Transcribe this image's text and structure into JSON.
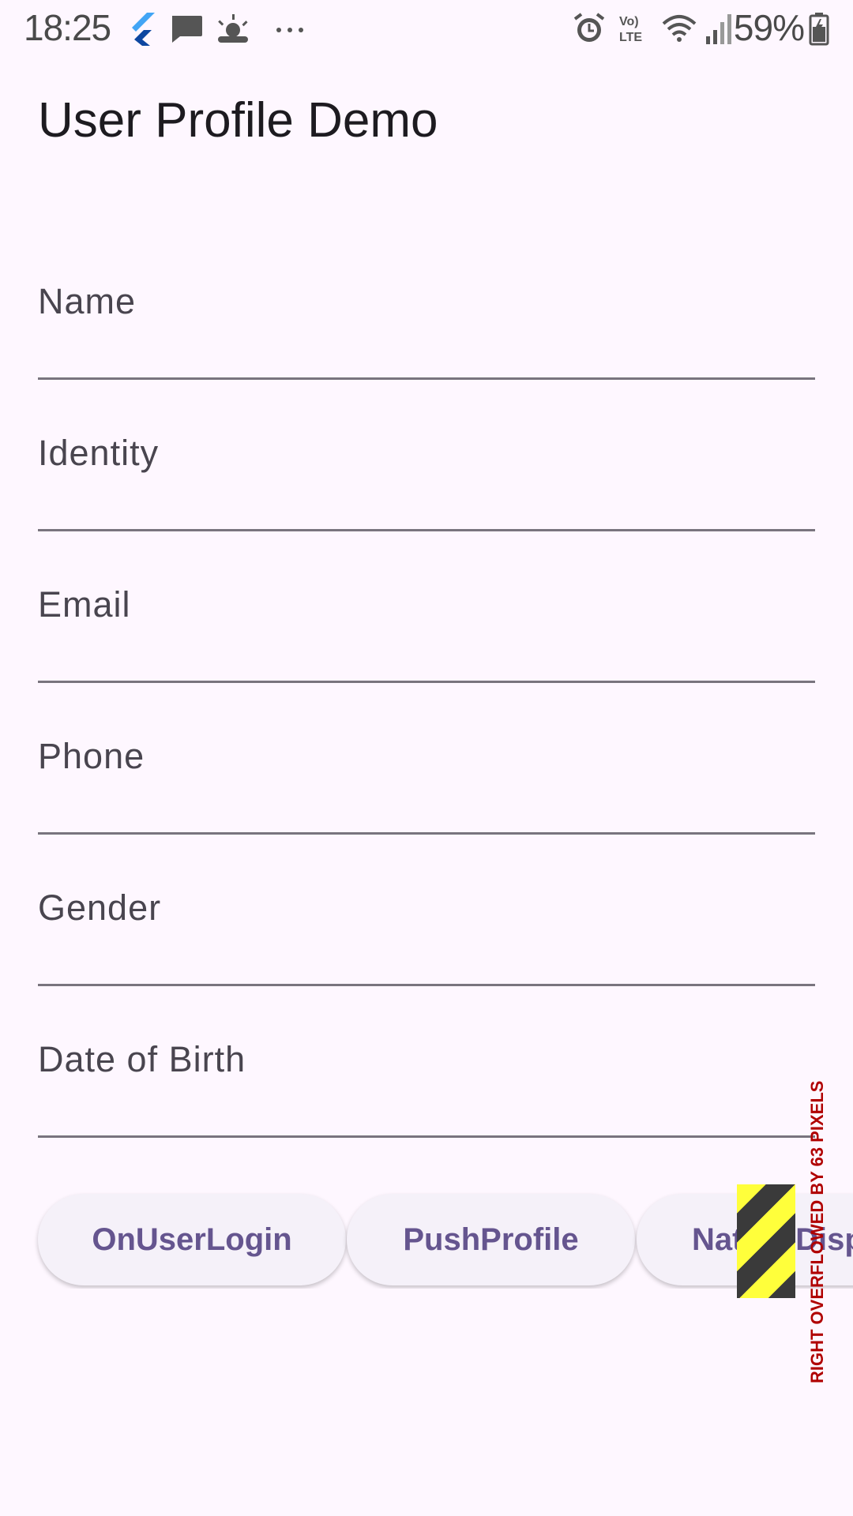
{
  "status_bar": {
    "time": "18:25",
    "battery_percent": "59%",
    "icons": [
      "flutter-icon",
      "message-icon",
      "weather-icon",
      "more-icon",
      "alarm-icon",
      "volte-icon",
      "wifi-icon",
      "signal-icon",
      "battery-icon"
    ]
  },
  "app_bar": {
    "title": "User Profile Demo"
  },
  "form": {
    "fields": [
      {
        "label": "Name",
        "value": ""
      },
      {
        "label": "Identity",
        "value": ""
      },
      {
        "label": "Email",
        "value": ""
      },
      {
        "label": "Phone",
        "value": ""
      },
      {
        "label": "Gender",
        "value": ""
      },
      {
        "label": "Date of Birth",
        "value": ""
      }
    ]
  },
  "buttons": {
    "on_user_login": "OnUserLogin",
    "push_profile": "PushProfile",
    "native_display": "Native Disp"
  },
  "overflow_warning": {
    "text": "RIGHT OVERFLOWED BY 63 PIXELS"
  },
  "colors": {
    "background": "#fef7ff",
    "button_text": "#65558f",
    "button_bg": "#f5f1f9",
    "underline": "#79747e"
  }
}
